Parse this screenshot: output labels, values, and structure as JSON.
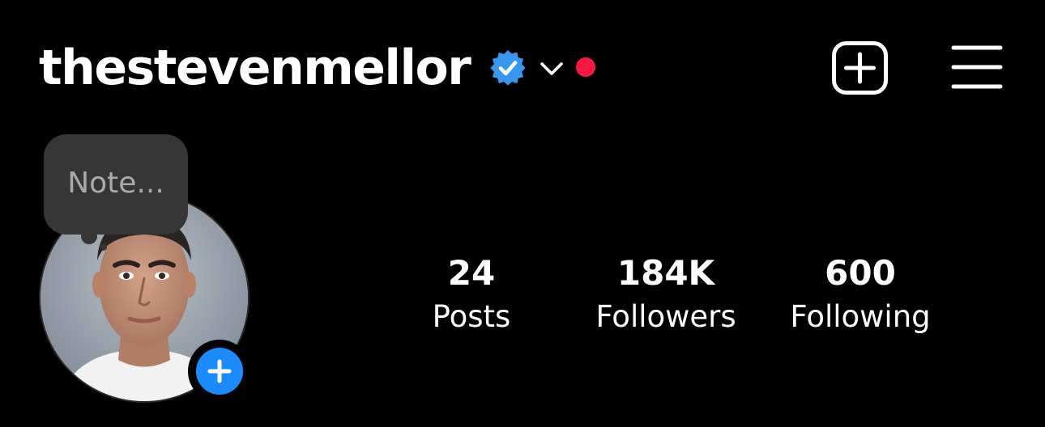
{
  "header": {
    "username": "thestevenmellor",
    "verified_icon": "verified-badge-icon",
    "dropdown_icon": "chevron-down-icon",
    "notification_icon": "red-dot",
    "new_post_icon": "plus-square-icon",
    "menu_icon": "hamburger-menu-icon"
  },
  "note": {
    "placeholder": "Note..."
  },
  "profile": {
    "avatar": "profile-photo",
    "add_story_icon": "plus-icon"
  },
  "stats": {
    "posts": {
      "value": "24",
      "label": "Posts"
    },
    "followers": {
      "value": "184K",
      "label": "Followers"
    },
    "following": {
      "value": "600",
      "label": "Following"
    }
  },
  "colors": {
    "background": "#000000",
    "text": "#ffffff",
    "verified_blue": "#3897f0",
    "notification_red": "#ff1744",
    "add_story_blue": "#1b8cff",
    "note_bubble": "#363636",
    "note_text": "#a9a9a9"
  }
}
